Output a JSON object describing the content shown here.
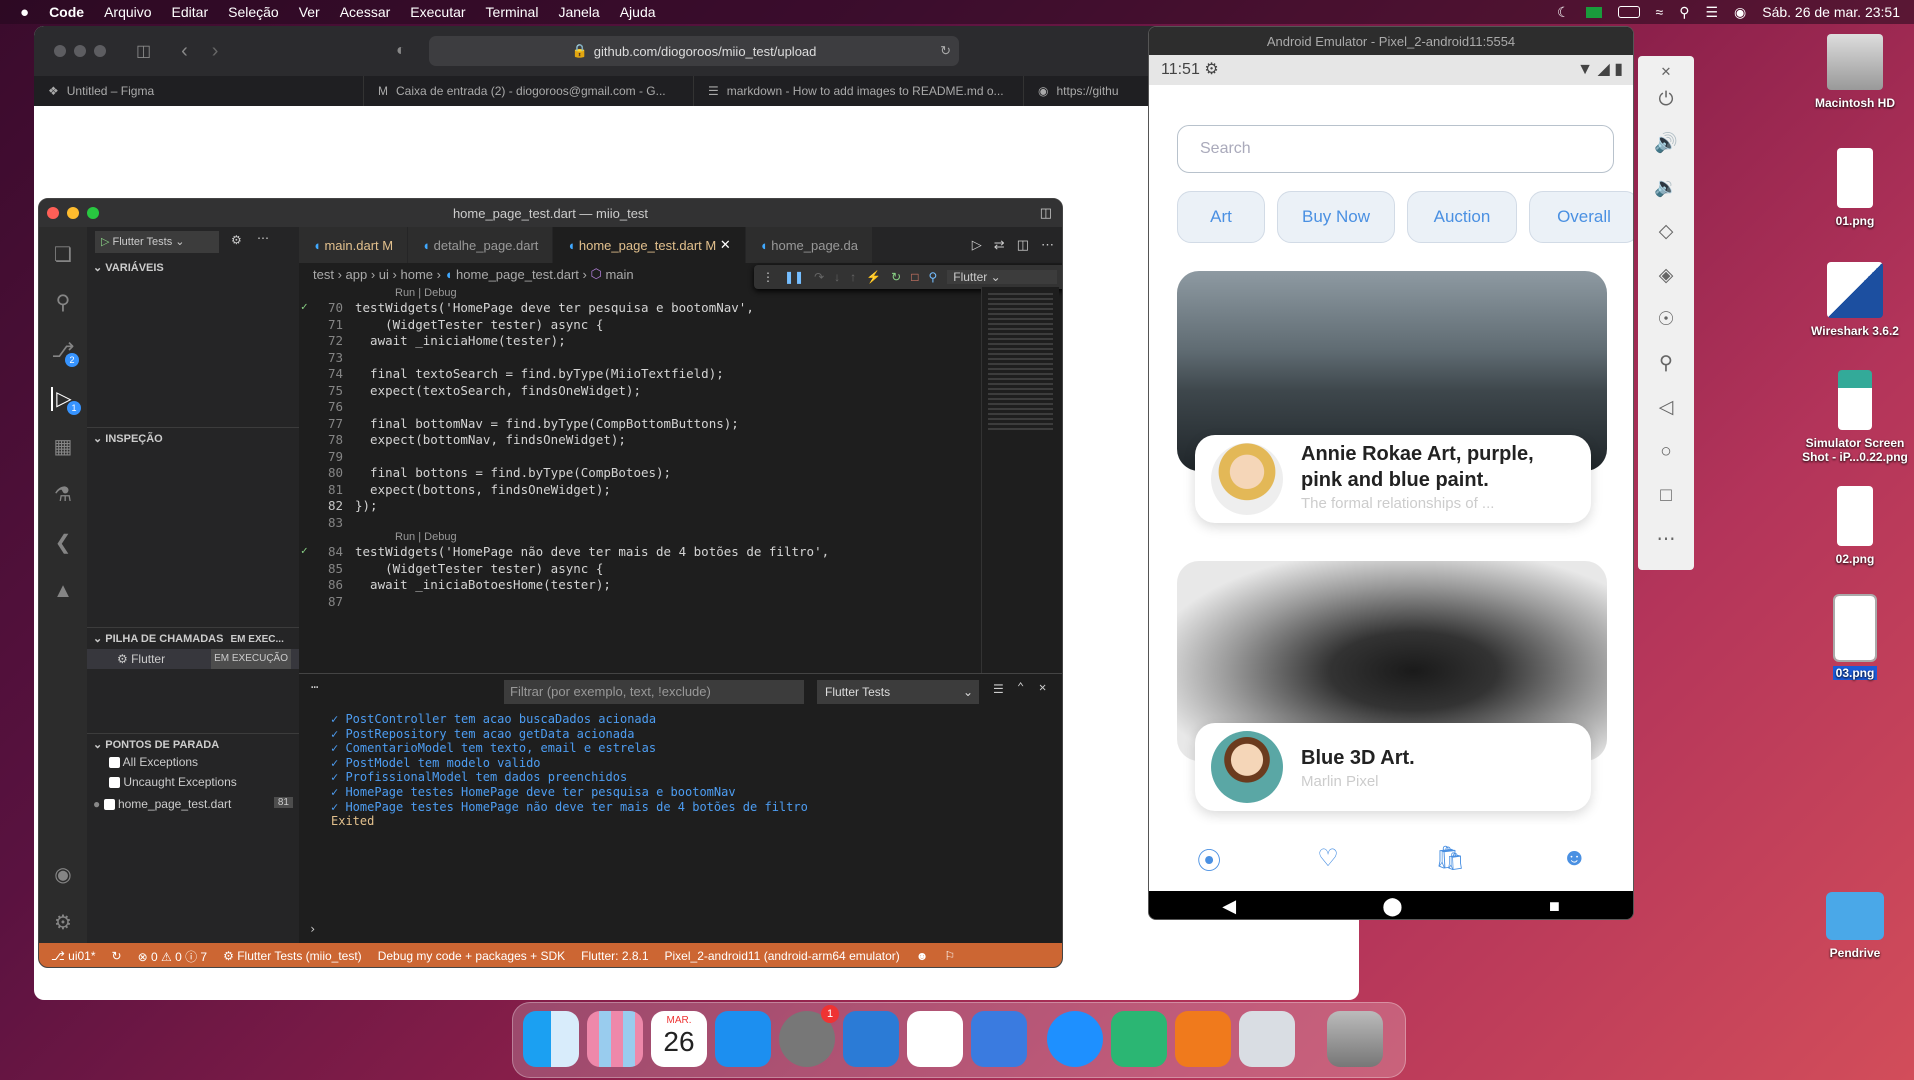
{
  "menubar": {
    "apple": "",
    "items": [
      "Code",
      "Arquivo",
      "Editar",
      "Seleção",
      "Ver",
      "Acessar",
      "Executar",
      "Terminal",
      "Janela",
      "Ajuda"
    ],
    "datetime": "Sáb. 26 de mar.  23:51"
  },
  "browser": {
    "url": "github.com/diogoroos/miio_test/upload",
    "tabs": [
      "Untitled – Figma",
      "Caixa de entrada (2) - diogoroos@gmail.com - G...",
      "markdown - How to add images to README.md o...",
      "https://githu"
    ]
  },
  "vscode": {
    "title": "home_page_test.dart — miio_test",
    "run_config": "Flutter Tests",
    "tabs": [
      {
        "label": "main.dart",
        "mod": "M"
      },
      {
        "label": "detalhe_page.dart",
        "mod": ""
      },
      {
        "label": "home_page_test.dart",
        "mod": "M"
      },
      {
        "label": "home_page.da",
        "mod": ""
      }
    ],
    "breadcrumb": [
      "test",
      "app",
      "ui",
      "home",
      "home_page_test.dart",
      "main"
    ],
    "debug_select": "Flutter",
    "sidebar": {
      "variables": "VARIÁVEIS",
      "inspect": "INSPEÇÃO",
      "callstack": "PILHA DE CHAMADAS",
      "callstack_badge": "EM EXEC...",
      "thread": "Flutter",
      "thread_state": "EM EXECUÇÃO",
      "breakpoints": "PONTOS DE PARADA",
      "bp": [
        {
          "label": "All Exceptions"
        },
        {
          "label": "Uncaught Exceptions"
        },
        {
          "label": "home_page_test.dart",
          "count": "81"
        }
      ]
    },
    "code": [
      {
        "lens": "Run | Debug"
      },
      {
        "n": "70",
        "t": "testWidgets('HomePage deve ter pesquisa e bootomNav',",
        "pass": true
      },
      {
        "n": "71",
        "t": "    (WidgetTester tester) async {"
      },
      {
        "n": "72",
        "t": "  await _iniciaHome(tester);"
      },
      {
        "n": "73",
        "t": ""
      },
      {
        "n": "74",
        "t": "  final textoSearch = find.byType(MiioTextfield);"
      },
      {
        "n": "75",
        "t": "  expect(textoSearch, findsOneWidget);"
      },
      {
        "n": "76",
        "t": ""
      },
      {
        "n": "77",
        "t": "  final bottomNav = find.byType(CompBottomButtons);"
      },
      {
        "n": "78",
        "t": "  expect(bottomNav, findsOneWidget);"
      },
      {
        "n": "79",
        "t": ""
      },
      {
        "n": "80",
        "t": "  final bottons = find.byType(CompBotoes);"
      },
      {
        "n": "81",
        "t": "  expect(bottons, findsOneWidget);"
      },
      {
        "n": "82",
        "t": "});"
      },
      {
        "n": "83",
        "t": ""
      },
      {
        "lens": "Run | Debug"
      },
      {
        "n": "84",
        "t": "testWidgets('HomePage não deve ter mais de 4 botões de filtro',",
        "pass": true
      },
      {
        "n": "85",
        "t": "    (WidgetTester tester) async {"
      },
      {
        "n": "86",
        "t": "  await _iniciaBotoesHome(tester);"
      },
      {
        "n": "87",
        "t": ""
      }
    ],
    "panel": {
      "filter_placeholder": "Filtrar (por exemplo, text, !exclude)",
      "select": "Flutter Tests",
      "lines": [
        "✓ PostController tem acao buscaDados acionada",
        "✓ PostRepository tem acao getData acionada",
        "✓ ComentarioModel tem texto, email e estrelas",
        "✓ PostModel tem modelo valido",
        "✓ ProfissionalModel tem dados preenchidos",
        "✓ HomePage testes HomePage deve ter pesquisa e bootomNav",
        "✓ HomePage testes HomePage não deve ter mais de 4 botões de filtro"
      ],
      "exited": "Exited"
    },
    "status": [
      "ui01*",
      "⊗ 0 ⚠ 0 ⓘ 7",
      "Flutter Tests (miio_test)",
      "Debug my code + packages + SDK",
      "Flutter: 2.8.1",
      "Pixel_2-android11 (android-arm64 emulator)"
    ],
    "badges": {
      "scm": "2",
      "debug": "1"
    }
  },
  "emulator": {
    "title": "Android Emulator - Pixel_2-android11:5554",
    "time": "11:51",
    "search_placeholder": "Search",
    "chips": [
      "Art",
      "Buy Now",
      "Auction",
      "Overall"
    ],
    "cards": [
      {
        "title": "Annie Rokae Art, purple, pink and blue paint.",
        "subtitle": "The formal relationships of ..."
      },
      {
        "title": "Blue 3D Art.",
        "subtitle": "Marlin Pixel"
      }
    ]
  },
  "desktop": [
    {
      "label": "Macintosh HD"
    },
    {
      "label": "01.png"
    },
    {
      "label": "Wireshark 3.6.2"
    },
    {
      "label": "Simulator Screen Shot - iP...0.22.png"
    },
    {
      "label": "02.png"
    },
    {
      "label": "03.png"
    },
    {
      "label": "Pendrive"
    }
  ],
  "dock": {
    "calendar_month": "MAR.",
    "calendar_day": "26",
    "settings_badge": "1"
  }
}
